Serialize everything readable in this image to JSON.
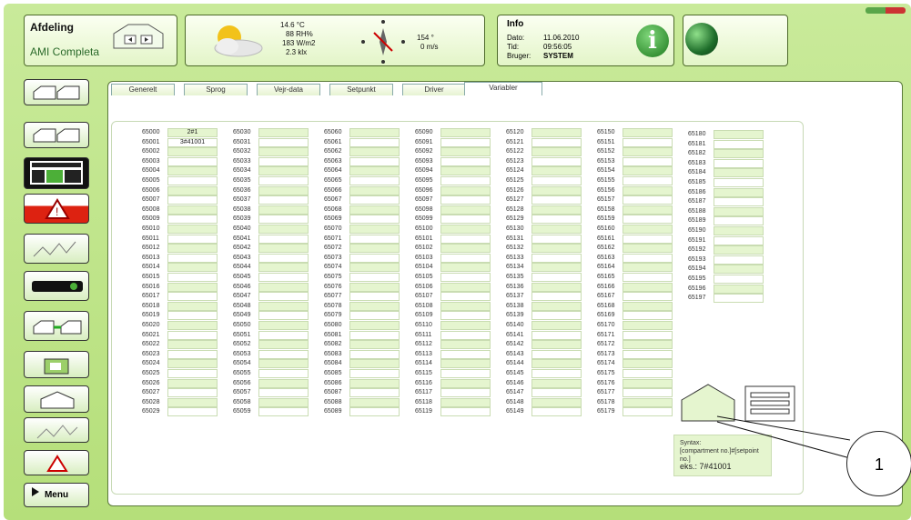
{
  "header": {
    "afdeling_title": "Afdeling",
    "afdeling_name": "AMI Completa",
    "weather": {
      "temp": "14.6 °C",
      "rh": "88 RH%",
      "rad": "183 W/m2",
      "lux": "2.3 klx",
      "wind_dir": "154 °",
      "wind_speed": "0 m/s"
    },
    "info": {
      "title": "Info",
      "dato_label": "Dato:",
      "dato": "11.06.2010",
      "tid_label": "Tid:",
      "tid": "09:56:05",
      "bruger_label": "Bruger:",
      "bruger": "SYSTEM"
    }
  },
  "tabs": [
    "Generelt",
    "Sprog",
    "Vejr-data",
    "Setpunkt",
    "Driver",
    "Variabler"
  ],
  "active_tab": "Variabler",
  "variables": {
    "columns": [
      {
        "start": 65000,
        "count": 30
      },
      {
        "start": 65030,
        "count": 30
      },
      {
        "start": 65060,
        "count": 30
      },
      {
        "start": 65090,
        "count": 30
      },
      {
        "start": 65120,
        "count": 30
      },
      {
        "start": 65150,
        "count": 30
      },
      {
        "start": 65180,
        "count": 18
      }
    ],
    "values": {
      "65000": "2#1",
      "65001": "3#41001"
    }
  },
  "syntax": {
    "line1": "Syntax:",
    "line2": "[compartment no.]#[setpoint no.]",
    "example": "eks.: 7#41001"
  },
  "sidebar": {
    "menu_label": "Menu"
  },
  "callout": "1",
  "icons": [
    "house-icon",
    "sun-cloud-icon",
    "compass-icon",
    "info-icon",
    "globe-icon",
    "chart-icon",
    "alarm-icon",
    "graph-icon",
    "wrench-icon",
    "transfer-icon",
    "folder-icon",
    "arrow-right-icon"
  ]
}
